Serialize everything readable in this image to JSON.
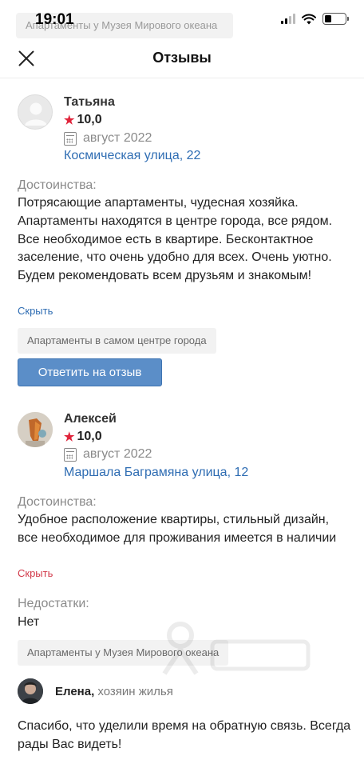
{
  "status_bar": {
    "time": "19:01",
    "ghost_tag": "Апартаменты у Музея Мирового океана"
  },
  "header": {
    "title": "Отзывы"
  },
  "reviews": [
    {
      "author": "Татьяна",
      "rating": "10,0",
      "date": "август 2022",
      "address": "Космическая улица, 22",
      "pros_label": "Достоинства:",
      "pros_text": "Потрясающие апартаменты, чудесная хозяйка. Апартаменты находятся в центре города, все рядом. Все необходимое есть в квартире. Бесконтактное заселение, что очень удобно для всех. Очень уютно. Будем рекомендовать всем друзьям и знакомым!",
      "hide": "Скрыть",
      "apartment": "Апартаменты в самом центре города",
      "reply_button": "Ответить на отзыв"
    },
    {
      "author": "Алексей",
      "rating": "10,0",
      "date": "август 2022",
      "address": "Маршала Баграмяна улица, 12",
      "pros_label": "Достоинства:",
      "pros_text": "Удобное расположение квартиры, стильный дизайн, все необходимое для проживания имеется в наличии",
      "hide": "Скрыть",
      "cons_label": "Недостатки:",
      "cons_text": "Нет",
      "apartment": "Апартаменты у Музея Мирового океана"
    }
  ],
  "owner_reply": {
    "name": "Елена,",
    "role": "хозяин жилья",
    "text": "Спасибо, что уделили время на обратную связь. Всегда рады Вас видеть!"
  },
  "colors": {
    "link": "#2f6db3",
    "star": "#e0243b",
    "reply_button": "#5b8ec8",
    "hide_red": "#d23a4a"
  }
}
